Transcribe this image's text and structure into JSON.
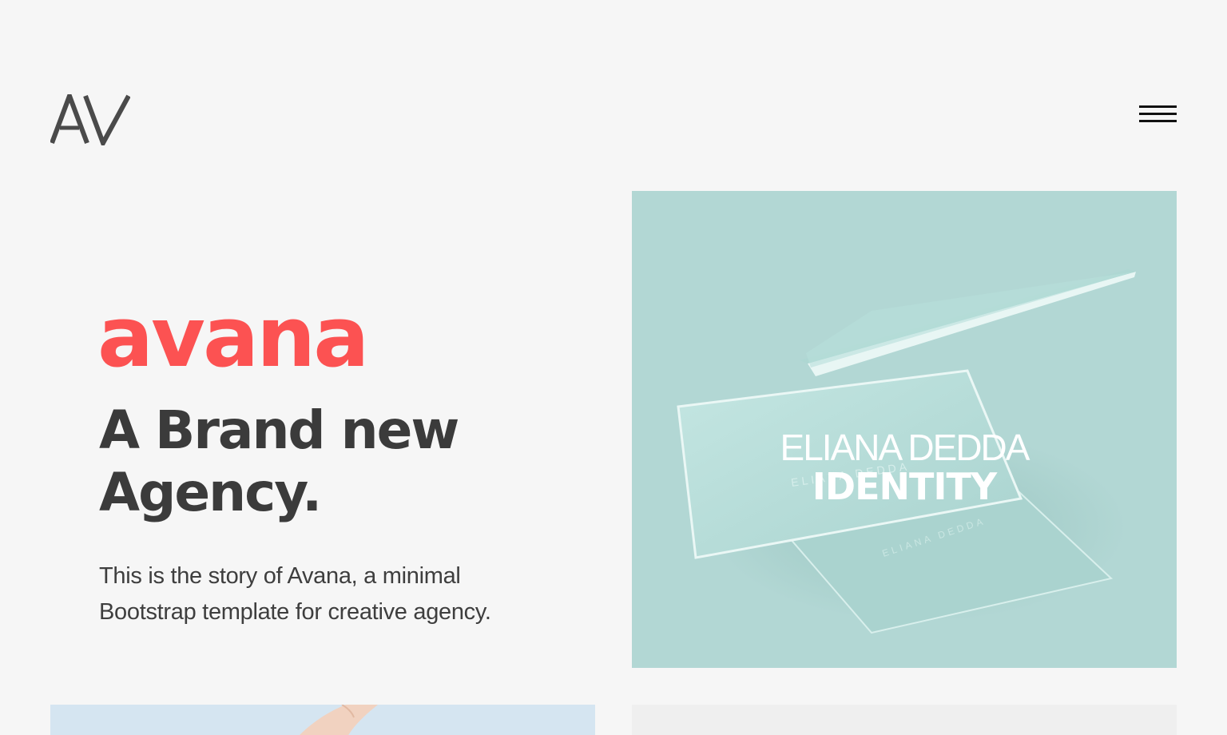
{
  "header": {
    "logo_text": "AV",
    "menu_icon": "hamburger-icon"
  },
  "hero": {
    "brand": "avana",
    "headline": "A Brand new Agency.",
    "lead": "This is the story of Avana, a minimal Bootstrap template for creative agency."
  },
  "portfolio": {
    "items": [
      {
        "title": "ELIANA DEDDA",
        "category": "IDENTITY"
      }
    ]
  },
  "colors": {
    "accent": "#fc5252",
    "heading": "#3b3b3b",
    "background": "#f6f6f6",
    "card_bg": "#b2d7d4"
  }
}
